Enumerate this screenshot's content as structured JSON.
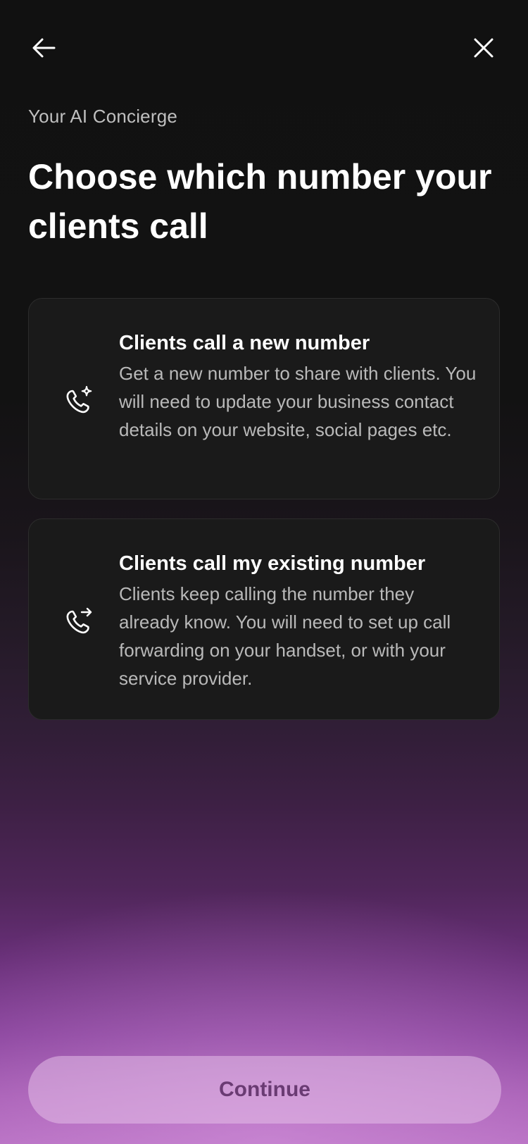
{
  "header": {
    "back_icon": "arrow-left-icon",
    "close_icon": "close-icon"
  },
  "eyebrow": "Your AI Concierge",
  "title": "Choose which number your clients call",
  "options": [
    {
      "icon": "phone-sparkle-icon",
      "title": "Clients call a new number",
      "description": "Get a new number to share with clients. You will need to update your business contact details on your website, social pages etc."
    },
    {
      "icon": "phone-forward-icon",
      "title": "Clients call my existing number",
      "description": "Clients keep calling the number they already know. You will need to set up call forwarding on your handset, or with your service provider."
    }
  ],
  "continue_label": "Continue",
  "colors": {
    "background_top": "#111111",
    "background_bottom": "#b46cc0",
    "card_background": "#1a1a1a",
    "continue_background": "#d7a8da",
    "continue_text": "#6a3b73"
  }
}
